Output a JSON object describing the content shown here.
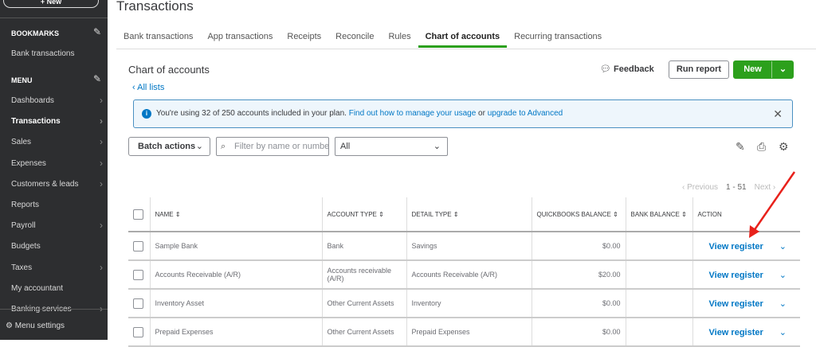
{
  "sidebar": {
    "new_label": "+ New",
    "bookmarks_label": "BOOKMARKS",
    "bookmarks": [
      "Bank transactions"
    ],
    "menu_label": "MENU",
    "items": [
      {
        "label": "Dashboards",
        "chev": true
      },
      {
        "label": "Transactions",
        "chev": true,
        "active": true
      },
      {
        "label": "Sales",
        "chev": true
      },
      {
        "label": "Expenses",
        "chev": true
      },
      {
        "label": "Customers & leads",
        "chev": true
      },
      {
        "label": "Reports",
        "chev": false
      },
      {
        "label": "Payroll",
        "chev": true
      },
      {
        "label": "Budgets",
        "chev": false
      },
      {
        "label": "Taxes",
        "chev": true
      },
      {
        "label": "My accountant",
        "chev": false
      },
      {
        "label": "Banking services",
        "chev": true
      }
    ],
    "settings_label": "Menu settings"
  },
  "page_title": "Transactions",
  "tabs": [
    "Bank transactions",
    "App transactions",
    "Receipts",
    "Reconcile",
    "Rules",
    "Chart of accounts",
    "Recurring transactions"
  ],
  "section_title": "Chart of accounts",
  "all_lists": "All lists",
  "feedback": "Feedback",
  "run_report": "Run report",
  "new_label": "New",
  "banner": {
    "text": "You're using 32 of 250 accounts included in your plan. ",
    "link1": "Find out how to manage your usage",
    "or": " or ",
    "link2": "upgrade to Advanced"
  },
  "batch_actions": "Batch actions",
  "filter_placeholder": "Filter by name or number",
  "filter_value": "All",
  "pagination": {
    "prev": "Previous",
    "range": "1 - 51",
    "next": "Next"
  },
  "columns": [
    "NAME",
    "ACCOUNT TYPE",
    "DETAIL TYPE",
    "QUICKBOOKS BALANCE",
    "BANK BALANCE",
    "ACTION"
  ],
  "rows": [
    {
      "name": "Sample Bank",
      "type": "Bank",
      "detail": "Savings",
      "qb": "$0.00",
      "bank": "",
      "action": "View register"
    },
    {
      "name": "Accounts Receivable (A/R)",
      "type": "Accounts receivable (A/R)",
      "detail": "Accounts Receivable (A/R)",
      "qb": "$20.00",
      "bank": "",
      "action": "View register"
    },
    {
      "name": "Inventory Asset",
      "type": "Other Current Assets",
      "detail": "Inventory",
      "qb": "$0.00",
      "bank": "",
      "action": "View register"
    },
    {
      "name": "Prepaid Expenses",
      "type": "Other Current Assets",
      "detail": "Prepaid Expenses",
      "qb": "$0.00",
      "bank": "",
      "action": "View register"
    }
  ]
}
